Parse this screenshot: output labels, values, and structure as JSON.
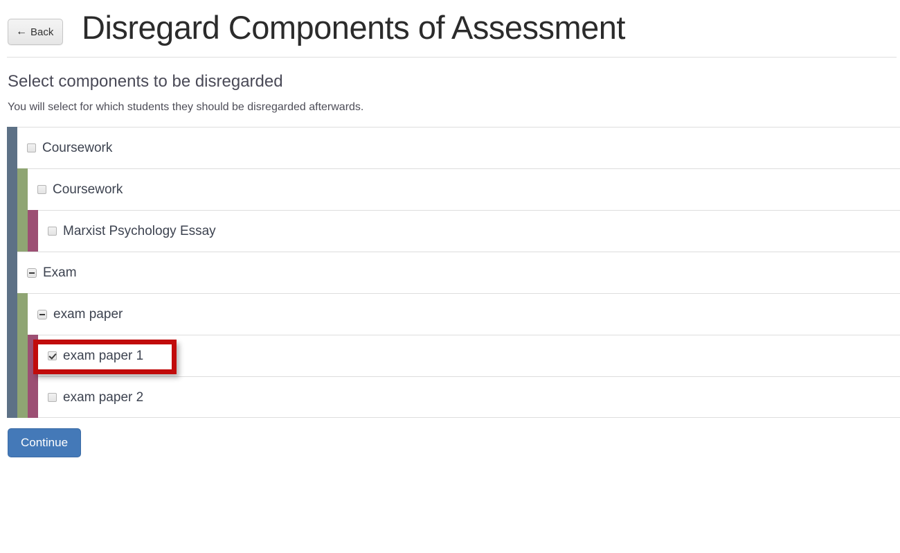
{
  "header": {
    "back_label": "Back",
    "back_icon": "arrow-left-icon",
    "title": "Disregard Components of Assessment"
  },
  "intro": {
    "heading": "Select components to be disregarded",
    "subtext": "You will select for which students they should be disregarded afterwards."
  },
  "tree": {
    "rows": [
      {
        "label": "Coursework",
        "level": 1,
        "control": "checkbox",
        "checked": false,
        "highlighted": false
      },
      {
        "label": "Coursework",
        "level": 2,
        "control": "checkbox",
        "checked": false,
        "highlighted": false
      },
      {
        "label": "Marxist Psychology Essay",
        "level": 3,
        "control": "checkbox",
        "checked": false,
        "highlighted": false
      },
      {
        "label": "Exam",
        "level": 1,
        "control": "toggle-collapse",
        "checked": false,
        "highlighted": false
      },
      {
        "label": "exam paper",
        "level": 2,
        "control": "toggle-collapse",
        "checked": false,
        "highlighted": false
      },
      {
        "label": "exam paper 1",
        "level": 3,
        "control": "checkbox",
        "checked": true,
        "highlighted": true
      },
      {
        "label": "exam paper 2",
        "level": 3,
        "control": "checkbox",
        "checked": false,
        "highlighted": false
      }
    ]
  },
  "footer": {
    "continue_label": "Continue"
  },
  "colors": {
    "rail_level_1": "#5d7186",
    "rail_level_2": "#8fa573",
    "rail_level_3": "#9c4f73",
    "primary_button": "#4479b8",
    "annotation": "#c10b0b",
    "row_border": "#dddddd"
  }
}
